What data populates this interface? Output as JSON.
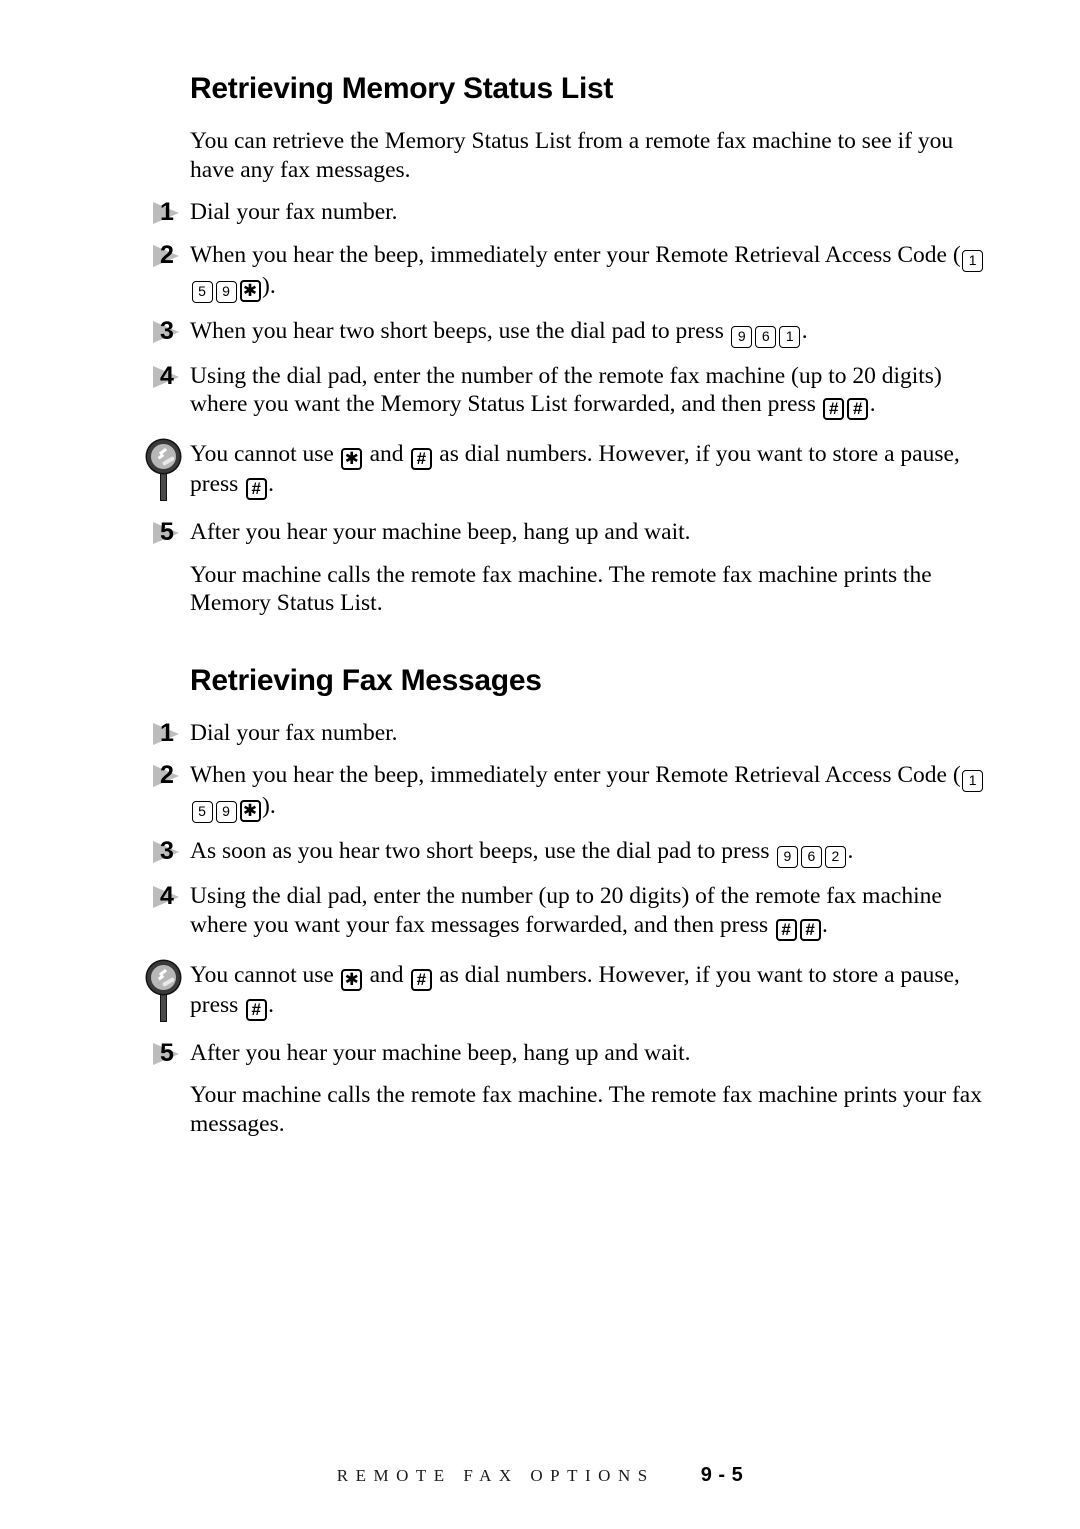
{
  "page": {
    "background_color": "#ffffff",
    "text_color": "#000000",
    "marker_gray": "#bcbcbc"
  },
  "sections": [
    {
      "heading": "Retrieving Memory Status List",
      "intro": "You can retrieve the Memory Status List from a remote fax machine to see if you have any fax messages.",
      "steps": [
        {
          "number": "1",
          "text": "Dial your fax number."
        },
        {
          "number": "2",
          "text_before": "When you hear the beep, immediately enter your Remote Retrieval Access Code (",
          "keys": [
            "1",
            "5",
            "9",
            "✱"
          ],
          "text_after": ")."
        },
        {
          "number": "3",
          "text_before": "When you hear two short beeps, use the dial pad to press ",
          "keys": [
            "9",
            "6",
            "1"
          ],
          "text_after": "."
        },
        {
          "number": "4",
          "text_before": "Using the dial pad, enter the number of the remote fax machine (up to 20 digits) where you want the Memory Status List forwarded, and then press ",
          "keys": [
            "#",
            "#"
          ],
          "text_after": "."
        },
        {
          "number": "5",
          "text": "After you hear your machine beep, hang up and wait."
        }
      ],
      "note": {
        "icon": "magnifier-icon",
        "part1": "You cannot use ",
        "key1": "✱",
        "part2": " and ",
        "key2": "#",
        "part3": " as dial numbers.  However, if you want to store a pause, press ",
        "key3": "#",
        "part4": "."
      },
      "closing": "Your machine calls the remote fax machine. The remote fax machine prints the Memory Status List."
    },
    {
      "heading": "Retrieving Fax Messages",
      "steps": [
        {
          "number": "1",
          "text": "Dial your fax number."
        },
        {
          "number": "2",
          "text_before": "When you hear the beep, immediately enter your Remote Retrieval Access Code (",
          "keys": [
            "1",
            "5",
            "9",
            "✱"
          ],
          "text_after": ")."
        },
        {
          "number": "3",
          "text_before": "As soon as you hear two short beeps, use the dial pad to press ",
          "keys": [
            "9",
            "6",
            "2"
          ],
          "text_after": "."
        },
        {
          "number": "4",
          "text_before": "Using the dial pad, enter the number (up to 20 digits) of the remote fax machine where you want your fax messages forwarded, and then press ",
          "keys": [
            "#",
            "#"
          ],
          "text_after": "."
        },
        {
          "number": "5",
          "text": "After you hear your machine beep, hang up and wait."
        }
      ],
      "note": {
        "icon": "magnifier-icon",
        "part1": "You cannot use ",
        "key1": "✱",
        "part2": " and ",
        "key2": "#",
        "part3": " as dial numbers.  However, if you want to store a pause, press ",
        "key3": "#",
        "part4": "."
      },
      "closing": "Your machine calls the remote fax machine.  The remote fax machine prints your fax messages."
    }
  ],
  "footer": {
    "title": "REMOTE FAX OPTIONS",
    "page_number": "9 - 5"
  }
}
